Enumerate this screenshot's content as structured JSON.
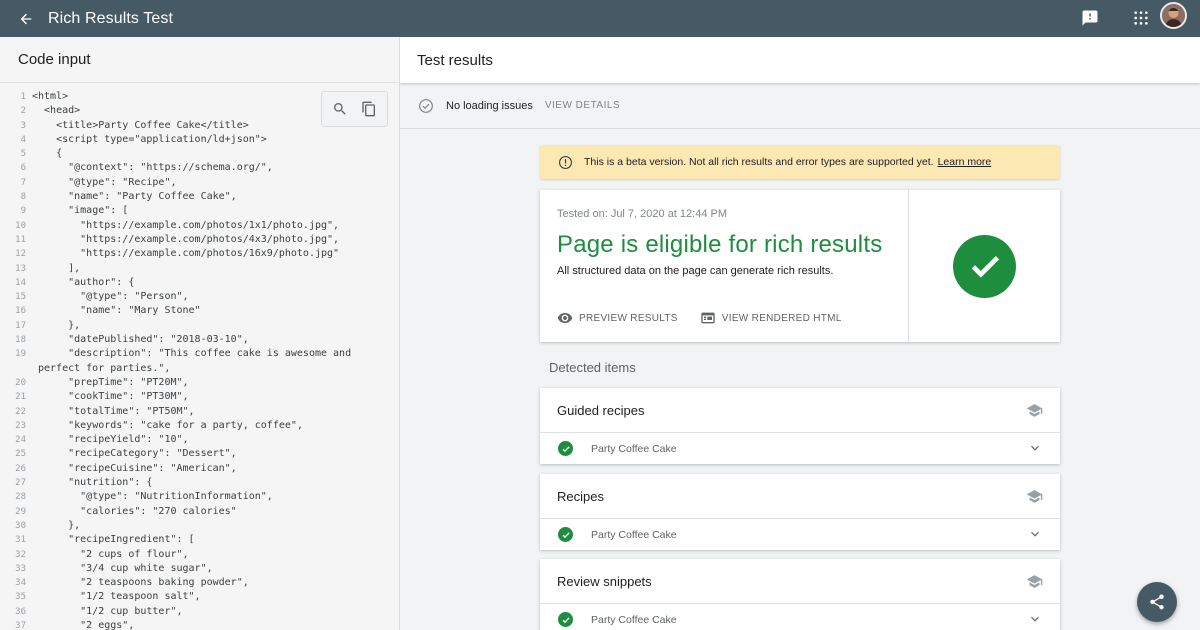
{
  "topbar": {
    "title": "Rich Results Test",
    "back_icon": "arrow-back-icon",
    "feedback_icon": "feedback-icon",
    "apps_icon": "apps-grid-icon",
    "avatar": "user-avatar"
  },
  "left": {
    "header": "Code input",
    "tools": [
      "search-icon",
      "copy-icon"
    ],
    "code_lines": [
      {
        "n": "1",
        "text": "<html>"
      },
      {
        "n": "2",
        "text": "  <head>"
      },
      {
        "n": "3",
        "text": "    <title>Party Coffee Cake</title>"
      },
      {
        "n": "4",
        "text": "    <script type=\"application/ld+json\">"
      },
      {
        "n": "5",
        "text": "    {"
      },
      {
        "n": "6",
        "text": "      \"@context\": \"https://schema.org/\","
      },
      {
        "n": "7",
        "text": "      \"@type\": \"Recipe\","
      },
      {
        "n": "8",
        "text": "      \"name\": \"Party Coffee Cake\","
      },
      {
        "n": "9",
        "text": "      \"image\": ["
      },
      {
        "n": "10",
        "text": "        \"https://example.com/photos/1x1/photo.jpg\","
      },
      {
        "n": "11",
        "text": "        \"https://example.com/photos/4x3/photo.jpg\","
      },
      {
        "n": "12",
        "text": "        \"https://example.com/photos/16x9/photo.jpg\""
      },
      {
        "n": "13",
        "text": "      ],"
      },
      {
        "n": "14",
        "text": "      \"author\": {"
      },
      {
        "n": "15",
        "text": "        \"@type\": \"Person\","
      },
      {
        "n": "16",
        "text": "        \"name\": \"Mary Stone\""
      },
      {
        "n": "17",
        "text": "      },"
      },
      {
        "n": "18",
        "text": "      \"datePublished\": \"2018-03-10\","
      },
      {
        "n": "19",
        "text": "      \"description\": \"This coffee cake is awesome and"
      },
      {
        "n": "",
        "text": "perfect for parties.\","
      },
      {
        "n": "20",
        "text": "      \"prepTime\": \"PT20M\","
      },
      {
        "n": "21",
        "text": "      \"cookTime\": \"PT30M\","
      },
      {
        "n": "22",
        "text": "      \"totalTime\": \"PT50M\","
      },
      {
        "n": "23",
        "text": "      \"keywords\": \"cake for a party, coffee\","
      },
      {
        "n": "24",
        "text": "      \"recipeYield\": \"10\","
      },
      {
        "n": "25",
        "text": "      \"recipeCategory\": \"Dessert\","
      },
      {
        "n": "26",
        "text": "      \"recipeCuisine\": \"American\","
      },
      {
        "n": "27",
        "text": "      \"nutrition\": {"
      },
      {
        "n": "28",
        "text": "        \"@type\": \"NutritionInformation\","
      },
      {
        "n": "29",
        "text": "        \"calories\": \"270 calories\""
      },
      {
        "n": "30",
        "text": "      },"
      },
      {
        "n": "31",
        "text": "      \"recipeIngredient\": ["
      },
      {
        "n": "32",
        "text": "        \"2 cups of flour\","
      },
      {
        "n": "33",
        "text": "        \"3/4 cup white sugar\","
      },
      {
        "n": "34",
        "text": "        \"2 teaspoons baking powder\","
      },
      {
        "n": "35",
        "text": "        \"1/2 teaspoon salt\","
      },
      {
        "n": "36",
        "text": "        \"1/2 cup butter\","
      },
      {
        "n": "37",
        "text": "        \"2 eggs\","
      }
    ]
  },
  "right": {
    "header": "Test results",
    "loading": {
      "text": "No loading issues",
      "details": "VIEW DETAILS"
    },
    "beta": {
      "message": "This is a beta version. Not all rich results and error types are supported yet.",
      "link": "Learn more"
    },
    "result": {
      "tested_on": "Tested on: Jul 7, 2020 at 12:44 PM",
      "title": "Page is eligible for rich results",
      "subtitle": "All structured data on the page can generate rich results.",
      "preview": "PREVIEW RESULTS",
      "view_html": "VIEW RENDERED HTML"
    },
    "detected_label": "Detected items",
    "items": [
      {
        "title": "Guided recipes",
        "entry": "Party Coffee Cake"
      },
      {
        "title": "Recipes",
        "entry": "Party Coffee Cake"
      },
      {
        "title": "Review snippets",
        "entry": "Party Coffee Cake"
      }
    ]
  },
  "colors": {
    "topbar": "#455a64",
    "success": "#1e8e3e",
    "beta_banner": "#fce8b2"
  },
  "fab_icon": "share-icon"
}
